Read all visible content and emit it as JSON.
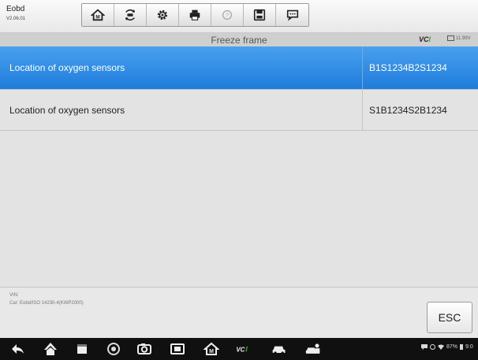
{
  "app": {
    "title": "Eobd",
    "version": "V2.06.01"
  },
  "toolbar": {
    "buttons": [
      "home-icon",
      "vehicle-swap-icon",
      "settings-gear-icon",
      "print-icon",
      "help-icon",
      "save-icon",
      "message-icon"
    ]
  },
  "header": {
    "title": "Freeze frame",
    "vci_prefix": "VC",
    "vci_suffix": "I",
    "battery_voltage": "11.99V"
  },
  "rows": [
    {
      "name": "Location of oxygen sensors",
      "value": "B1S1234B2S1234",
      "selected": true
    },
    {
      "name": "Location of oxygen sensors",
      "value": "S1B1234S2B1234",
      "selected": false
    }
  ],
  "footer": {
    "vin_label": "VIN:",
    "car_label": "Car: Eobd/ISO 14230-4(KWP2000)",
    "esc_label": "ESC"
  },
  "navbar": {
    "icons": [
      "back-icon",
      "home-icon",
      "recent-apps-icon",
      "chrome-icon",
      "camera-icon",
      "screen-record-icon",
      "maxisys-home-icon",
      "vci-icon",
      "car-icon",
      "car-service-icon"
    ],
    "status_text": "87%",
    "clock": "9:0"
  },
  "colors": {
    "selected_row": "#2a88e6",
    "background": "#e3e3e3",
    "vci_accent": "#3aa537",
    "navbar": "#101010"
  }
}
